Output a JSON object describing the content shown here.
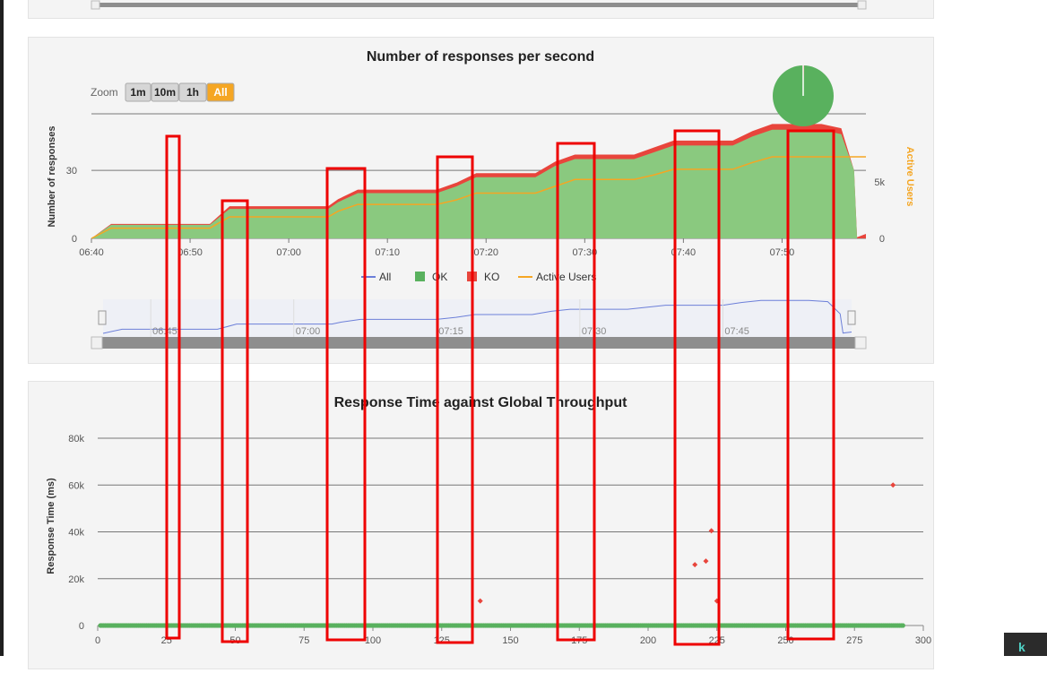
{
  "colors": {
    "ok": "#59b15e",
    "ok_fill": "#8ac97f",
    "ko": "#e8453c",
    "active_users": "#f5a623",
    "all": "#6c7fd9",
    "highlight_box": "#ee0000",
    "zoom_active": "#f5a623"
  },
  "rps_chart": {
    "title": "Number of responses per second",
    "zoom_label": "Zoom",
    "zoom_buttons": [
      {
        "label": "1m",
        "active": false
      },
      {
        "label": "10m",
        "active": false
      },
      {
        "label": "1h",
        "active": false
      },
      {
        "label": "All",
        "active": true
      }
    ],
    "legend": [
      "All",
      "OK",
      "KO",
      "Active Users"
    ],
    "navigator_ticks": [
      "06:45",
      "07:00",
      "07:15",
      "07:30",
      "07:45"
    ],
    "pie_ok_fraction": 0.995
  },
  "rt_chart": {
    "title": "Response Time against Global Throughput"
  },
  "chart_data": [
    {
      "type": "area",
      "title": "Number of responses per second",
      "xlabel": "",
      "ylabel": "Number of responses",
      "y2label": "Active Users",
      "x_ticks": [
        "06:40",
        "06:50",
        "07:00",
        "07:10",
        "07:20",
        "07:30",
        "07:40",
        "07:50"
      ],
      "y_ticks": [
        "0",
        "30"
      ],
      "y2_ticks": [
        "0",
        "5k"
      ],
      "ylim": [
        0,
        55
      ],
      "xlim_minutes": [
        0,
        78.5
      ],
      "grid": true,
      "legend_placement": "bottom",
      "series": [
        {
          "name": "OK",
          "x_minutes": [
            0,
            2,
            12,
            14,
            24,
            25,
            27,
            35,
            37,
            39,
            45,
            47,
            49,
            55,
            57,
            59,
            65,
            67,
            69,
            74,
            76,
            77.3,
            77.6,
            78.5
          ],
          "values": [
            0,
            6,
            6,
            13,
            13,
            16,
            20,
            20,
            23,
            27,
            27,
            32,
            35,
            35,
            38,
            41,
            41,
            45,
            48,
            48,
            46,
            30,
            0,
            0
          ]
        },
        {
          "name": "KO",
          "x_minutes": [
            0,
            2,
            12,
            14,
            24,
            25,
            27,
            35,
            37,
            39,
            45,
            47,
            49,
            55,
            57,
            59,
            65,
            67,
            69,
            74,
            76,
            77.3,
            77.6,
            78.5
          ],
          "values": [
            0,
            0.4,
            0.4,
            1.2,
            1.2,
            1.3,
            1.5,
            1.5,
            1.6,
            1.8,
            1.8,
            1.9,
            2,
            2,
            2.1,
            2.2,
            2.2,
            2.4,
            2.5,
            2.5,
            2.6,
            0,
            0.5,
            2
          ]
        },
        {
          "name": "Active Users",
          "x_minutes": [
            0,
            2,
            12,
            14,
            24,
            25,
            27,
            35,
            37,
            39,
            45,
            47,
            49,
            55,
            57,
            59,
            65,
            67,
            69,
            75,
            78.5
          ],
          "values": [
            0,
            900,
            900,
            1900,
            1900,
            2400,
            3000,
            3000,
            3400,
            4000,
            4000,
            4600,
            5200,
            5200,
            5600,
            6100,
            6100,
            6700,
            7200,
            7200,
            7200
          ]
        }
      ]
    },
    {
      "type": "scatter",
      "title": "Response Time against Global Throughput",
      "ylabel": "Response Time (ms)",
      "x_ticks": [
        "0",
        "25",
        "50",
        "75",
        "100",
        "125",
        "150",
        "175",
        "200",
        "225",
        "250",
        "275",
        "300"
      ],
      "y_ticks": [
        "0",
        "20k",
        "40k",
        "60k",
        "80k"
      ],
      "xlim": [
        0,
        300
      ],
      "ylim": [
        0,
        85000
      ],
      "grid": true,
      "series": [
        {
          "name": "OK",
          "x_range": [
            1,
            293
          ],
          "y": 0
        },
        {
          "name": "KO",
          "points": [
            [
              139,
              10500
            ],
            [
              217,
              26000
            ],
            [
              221,
              27500
            ],
            [
              223,
              40500
            ],
            [
              225,
              10500
            ],
            [
              289,
              60000
            ]
          ]
        }
      ]
    }
  ]
}
